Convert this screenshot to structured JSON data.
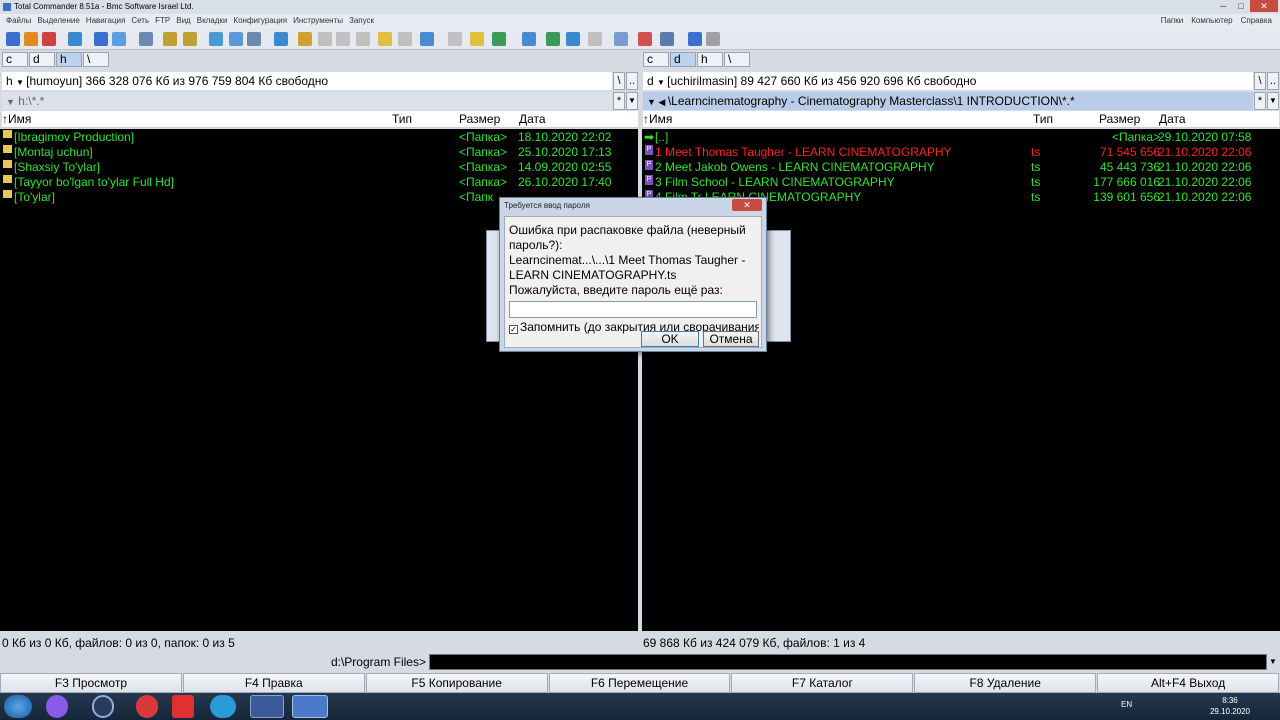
{
  "window": {
    "title": "Total Commander 8.51a - Bmc Software Israel Ltd."
  },
  "menu": {
    "items": [
      "Файлы",
      "Выделение",
      "Навигация",
      "Сеть",
      "FTP",
      "Вид",
      "Вкладки",
      "Конфигурация",
      "Инструменты",
      "Запуск"
    ],
    "right": [
      "Папки",
      "Компьютер",
      "Справка"
    ]
  },
  "left": {
    "drives": [
      "c",
      "d",
      "h",
      "\\"
    ],
    "drive_letter": "h",
    "drive_info": "[humoyun]  366 328 076 Кб из 976 759 804 Кб свободно",
    "path": "h:\\*.*",
    "columns": {
      "name": "Имя",
      "type": "Тип",
      "size": "Размер",
      "date": "Дата"
    },
    "rows": [
      {
        "name": "[Ibragimov Production]",
        "size": "<Папка>",
        "date": "18.10.2020 22:02"
      },
      {
        "name": "[Montaj uchun]",
        "size": "<Папка>",
        "date": "25.10.2020 17:13"
      },
      {
        "name": "[Shaxsiy To'ylar]",
        "size": "<Папка>",
        "date": "14.09.2020 02:55"
      },
      {
        "name": "[Tayyor bo'lgan to'ylar Full Hd]",
        "size": "<Папка>",
        "date": "26.10.2020 17:40"
      },
      {
        "name": "[To'ylar]",
        "size": "<Папк",
        "date": ""
      }
    ],
    "status": "0 Кб из 0 Кб, файлов: 0 из 0, папок: 0 из 5"
  },
  "right": {
    "drives": [
      "c",
      "d",
      "h",
      "\\"
    ],
    "drive_letter": "d",
    "drive_info": "[uchirilmasin]  89 427 660 Кб из 456 920 696 Кб свободно",
    "path": "\\Learncinematography - Cinematography Masterclass\\1 INTRODUCTION\\*.*",
    "columns": {
      "name": "Имя",
      "type": "Тип",
      "size": "Размер",
      "date": "Дата"
    },
    "rows": [
      {
        "name": "[..]",
        "type": "",
        "size": "<Папка>",
        "date": "29.10.2020 07:58",
        "color": "#2ee52e"
      },
      {
        "name": "1 Meet Thomas Taugher - LEARN CINEMATOGRAPHY",
        "type": "ts",
        "size": "71 545 656",
        "date": "21.10.2020 22:06",
        "color": "#ff2020"
      },
      {
        "name": "2 Meet Jakob Owens - LEARN CINEMATOGRAPHY",
        "type": "ts",
        "size": "45 443 736",
        "date": "21.10.2020 22:06",
        "color": "#2ee52e"
      },
      {
        "name": "3 Film School - LEARN CINEMATOGRAPHY",
        "type": "ts",
        "size": "177 666 016",
        "date": "21.10.2020 22:06",
        "color": "#2ee52e"
      },
      {
        "name": "4 Film Tr         LEARN CINEMATOGRAPHY",
        "type": "ts",
        "size": "139 601 656",
        "date": "21.10.2020 22:06",
        "color": "#2ee52e"
      }
    ],
    "status": "69 868 Кб из 424 079 Кб, файлов: 1 из 4"
  },
  "cmdline": {
    "prompt": "d:\\Program Files>"
  },
  "fkeys": [
    "F3 Просмотр",
    "F4 Правка",
    "F5 Копирование",
    "F6 Перемещение",
    "F7 Каталог",
    "F8 Удаление",
    "Alt+F4 Выход"
  ],
  "dialog": {
    "title": "Требуется ввод пароля",
    "message": "Ошибка при распаковке файла (неверный пароль?):",
    "file": "Learncinemat...\\...\\1 Meet Thomas Taugher - LEARN CINEMATOGRAPHY.ts",
    "prompt": "Пожалуйста, введите пароль ещё раз:",
    "remember": "Запомнить (до закрытия или сворачивания)",
    "ok": "OK",
    "cancel": "Отмена"
  },
  "taskbar": {
    "lang": "EN",
    "time": "8:36",
    "date": "29.10.2020"
  },
  "colors": {
    "panel_bg": "#000000",
    "file_green": "#2ee52e",
    "file_red": "#ff2020",
    "accent": "#bcd2ee"
  }
}
